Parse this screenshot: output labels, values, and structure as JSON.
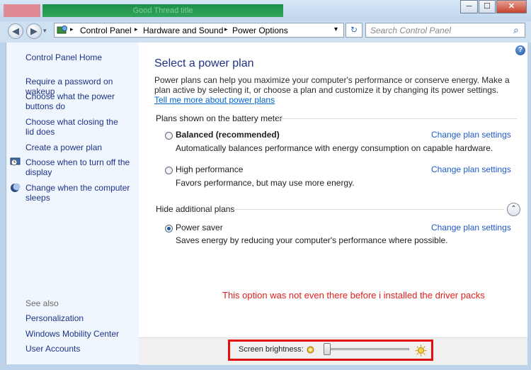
{
  "window": {
    "blurred_title": "Good Thread title",
    "min_glyph": "─",
    "max_glyph": "☐",
    "close_glyph": "✕"
  },
  "address": {
    "crumbs": [
      "Control Panel",
      "Hardware and Sound",
      "Power Options"
    ],
    "separator": "▸",
    "back_glyph": "◀",
    "forward_glyph": "▶",
    "dropdown_glyph": "▾",
    "refresh_glyph": "↻",
    "search_placeholder": "Search Control Panel",
    "search_glyph": "⌕"
  },
  "sidebar": {
    "home": "Control Panel Home",
    "links": [
      {
        "label": "Require a password on wakeup",
        "icon": null
      },
      {
        "label": "Choose what the power buttons do",
        "icon": null
      },
      {
        "label": "Choose what closing the lid does",
        "icon": null
      },
      {
        "label": "Create a power plan",
        "icon": null
      },
      {
        "label": "Choose when to turn off the display",
        "icon": "display-timer-icon"
      },
      {
        "label": "Change when the computer sleeps",
        "icon": "moon-icon"
      }
    ],
    "see_also_title": "See also",
    "see_also": [
      "Personalization",
      "Windows Mobility Center",
      "User Accounts"
    ]
  },
  "main": {
    "title": "Select a power plan",
    "description": "Power plans can help you maximize your computer's performance or conserve energy. Make a plan active by selecting it, or choose a plan and customize it by changing its power settings.",
    "tell_me_more": "Tell me more about power plans",
    "battery_meter_label": "Plans shown on the battery meter",
    "hide_label": "Hide additional plans",
    "change_settings_label": "Change plan settings",
    "plans": [
      {
        "name": "Balanced (recommended)",
        "desc": "Automatically balances performance with energy consumption on capable hardware.",
        "selected": false,
        "bold": true
      },
      {
        "name": "High performance",
        "desc": "Favors performance, but may use more energy.",
        "selected": false,
        "bold": false
      },
      {
        "name": "Power saver",
        "desc": "Saves energy by reducing your computer's performance where possible.",
        "selected": true,
        "bold": false
      }
    ],
    "annotation": "This option was not even there before i installed the driver packs",
    "help_glyph": "?",
    "collapse_glyph": "⌃"
  },
  "brightness": {
    "label": "Screen brightness:",
    "level": 0.02
  },
  "colors": {
    "link": "#1e5ac8",
    "heading": "#1e3287",
    "annotation": "#e21f1f",
    "highlight_border": "#e01010"
  }
}
